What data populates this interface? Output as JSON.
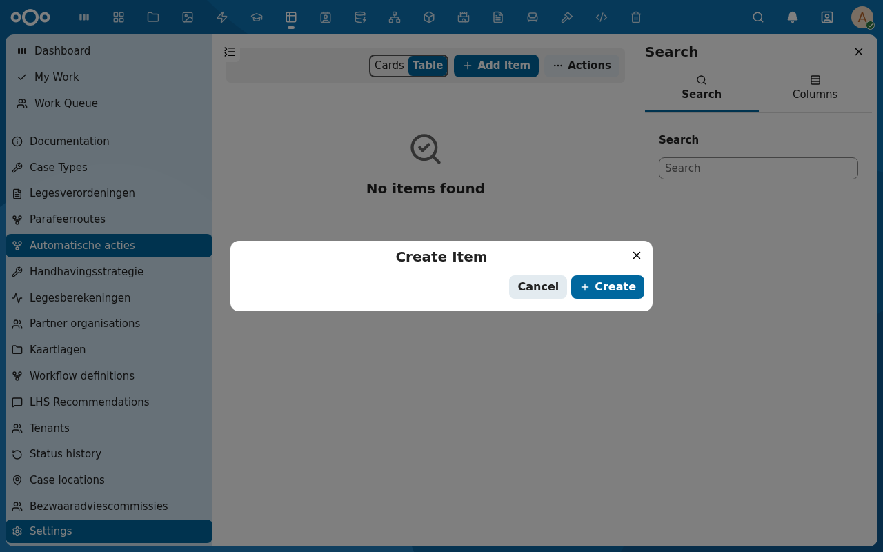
{
  "header": {
    "apps": [
      {
        "selected": false
      },
      {
        "selected": false
      },
      {
        "selected": false
      },
      {
        "selected": false
      },
      {
        "selected": false
      },
      {
        "selected": false
      },
      {
        "selected": true
      },
      {
        "selected": false
      },
      {
        "selected": false
      },
      {
        "selected": false
      },
      {
        "selected": false
      },
      {
        "selected": false
      },
      {
        "selected": false
      },
      {
        "selected": false
      },
      {
        "selected": false
      },
      {
        "selected": false
      },
      {
        "selected": false
      }
    ],
    "avatar": {
      "initial": "A",
      "online": true
    }
  },
  "sidebar": {
    "top_items": [
      {
        "label": "Dashboard"
      },
      {
        "label": "My Work"
      },
      {
        "label": "Work Queue"
      }
    ],
    "items": [
      {
        "label": "Documentation",
        "selected": false
      },
      {
        "label": "Case Types",
        "selected": false
      },
      {
        "label": "Legesverordeningen",
        "selected": false
      },
      {
        "label": "Parafeerroutes",
        "selected": false
      },
      {
        "label": "Automatische acties",
        "selected": true
      },
      {
        "label": "Handhavingsstrategie",
        "selected": false
      },
      {
        "label": "Legesberekeningen",
        "selected": false
      },
      {
        "label": "Partner organisations",
        "selected": false
      },
      {
        "label": "Kaartlagen",
        "selected": false
      },
      {
        "label": "Workflow definitions",
        "selected": false
      },
      {
        "label": "LHS Recommendations",
        "selected": false
      },
      {
        "label": "Tenants",
        "selected": false
      },
      {
        "label": "Status history",
        "selected": false
      },
      {
        "label": "Case locations",
        "selected": false
      },
      {
        "label": "Bezwaaradviescommissies",
        "selected": false
      }
    ],
    "footer": {
      "label": "Settings"
    }
  },
  "toolbar": {
    "views": [
      {
        "label": "Cards",
        "selected": false
      },
      {
        "label": "Table",
        "selected": true
      }
    ],
    "add_button": "Add Item",
    "actions_button": "Actions"
  },
  "empty_state": {
    "message": "No items found"
  },
  "right_panel": {
    "title": "Search",
    "tabs": [
      {
        "label": "Search",
        "selected": true
      },
      {
        "label": "Columns",
        "selected": false
      }
    ],
    "section_label": "Search",
    "search": {
      "placeholder": "Search"
    }
  },
  "dialog": {
    "title": "Create Item",
    "cancel": "Cancel",
    "create": "Create"
  }
}
